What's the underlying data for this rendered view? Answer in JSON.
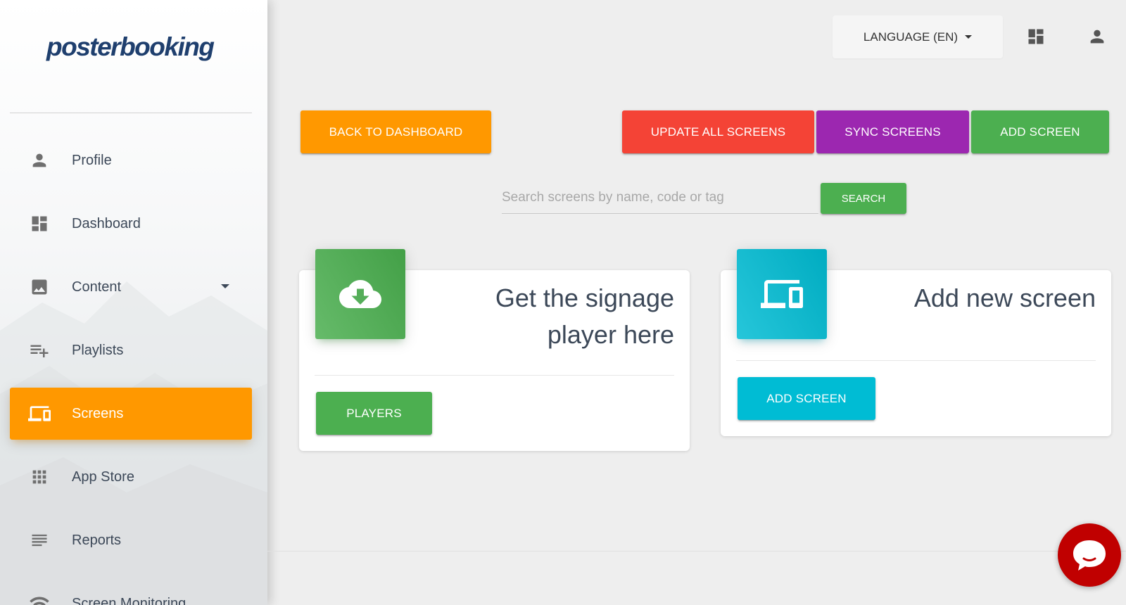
{
  "brand": {
    "logo_text": "posterbooking"
  },
  "sidebar": {
    "items": [
      {
        "label": "Profile",
        "icon": "person-icon"
      },
      {
        "label": "Dashboard",
        "icon": "dashboard-icon"
      },
      {
        "label": "Content",
        "icon": "image-icon",
        "has_dropdown": true
      },
      {
        "label": "Playlists",
        "icon": "playlist-add-icon"
      },
      {
        "label": "Screens",
        "icon": "devices-icon",
        "active": true
      },
      {
        "label": "App Store",
        "icon": "apps-grid-icon"
      },
      {
        "label": "Reports",
        "icon": "reports-lines-icon"
      },
      {
        "label": "Screen Monitoring",
        "icon": "wifi-icon"
      }
    ]
  },
  "topbar": {
    "language_label": "LANGUAGE (EN)",
    "icons": [
      "dashboard-icon",
      "person-icon"
    ]
  },
  "actions": {
    "back": "BACK TO DASHBOARD",
    "update_all": "UPDATE ALL SCREENS",
    "sync": "SYNC SCREENS",
    "add": "ADD SCREEN"
  },
  "search": {
    "placeholder": "Search screens by name, code or tag",
    "value": "",
    "button": "SEARCH"
  },
  "cards": [
    {
      "title_line1": "Get the signage",
      "title_line2": "player here",
      "icon": "cloud-download-icon",
      "button": "PLAYERS"
    },
    {
      "title_line1": "Add new screen",
      "icon": "devices-icon",
      "button": "ADD SCREEN"
    }
  ],
  "colors": {
    "orange": "#ff9800",
    "red": "#f44336",
    "purple": "#9c27b0",
    "green": "#4caf50",
    "cyan": "#00bcd4",
    "chat": "#c00000"
  }
}
